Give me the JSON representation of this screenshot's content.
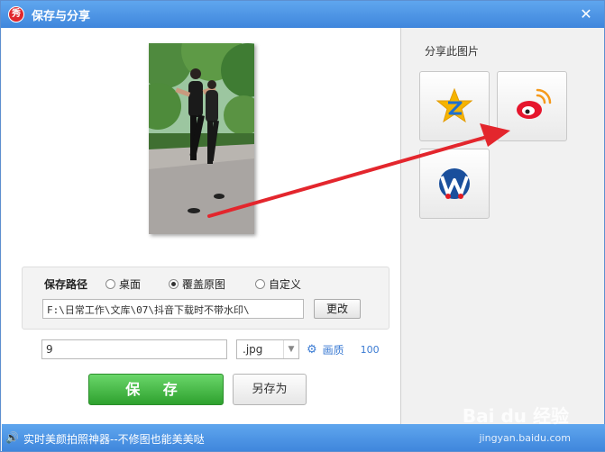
{
  "window": {
    "title": "保存与分享",
    "logo_text": "秀",
    "close_glyph": "✕"
  },
  "save_path": {
    "label": "保存路径",
    "options": [
      {
        "label": "桌面",
        "checked": false
      },
      {
        "label": "覆盖原图",
        "checked": true
      },
      {
        "label": "自定义",
        "checked": false
      }
    ],
    "path_value": "F:\\日常工作\\文库\\07\\抖音下载时不带水印\\",
    "change_label": "更改"
  },
  "file": {
    "name_value": "9",
    "format_value": ".jpg",
    "quality_label": "画质",
    "quality_value": "100"
  },
  "actions": {
    "save_label": "保 存",
    "save_as_label": "另存为"
  },
  "share": {
    "label": "分享此图片",
    "targets": [
      {
        "name": "qzone-icon",
        "color": "#f5b400"
      },
      {
        "name": "weibo-icon",
        "color": "#e6162d"
      },
      {
        "name": "renren-icon",
        "color": "#1a4f9c"
      }
    ]
  },
  "statusbar": {
    "text": "实时美颜拍照神器--不修图也能美美哒"
  },
  "watermark": {
    "text": "Bai du 经验",
    "sub": "jingyan.baidu.com"
  },
  "colors": {
    "titlebar": "#4a93e4",
    "save_green": "#3cb33c",
    "annotation_arrow": "#e3262d"
  }
}
